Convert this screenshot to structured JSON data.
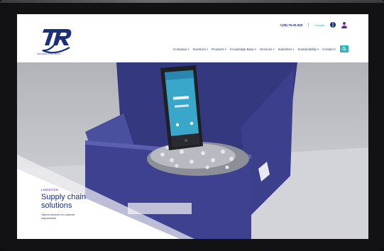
{
  "header": {
    "logo_tagline": "TRANSACTION DATA",
    "phone": "+(39) 75.00.000",
    "utility_link": "Contatti",
    "nav": [
      {
        "label": "Company"
      },
      {
        "label": "Investors"
      },
      {
        "label": "Products"
      },
      {
        "label": "Knowledge Base"
      },
      {
        "label": "Services"
      },
      {
        "label": "Industries"
      },
      {
        "label": "Sustainability"
      },
      {
        "label": "Contact"
      }
    ]
  },
  "hero": {
    "eyebrow": "LOGISTICS",
    "title_line1": "Supply chain",
    "title_line2": "solutions",
    "description": "Tailored services for customer requirements"
  },
  "colors": {
    "brand_navy": "#1c2f7a",
    "accent_teal": "#2fb3c2",
    "accent_purple": "#6b2a86",
    "bin_blue": "#3b3f8c"
  }
}
